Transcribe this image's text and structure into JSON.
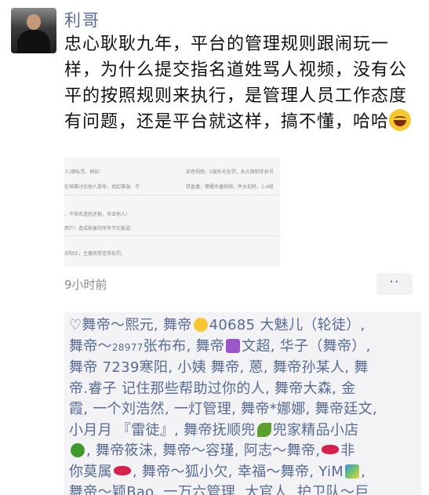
{
  "post": {
    "author": "利哥",
    "text": "忠心耿耿九年，平台的管理规则跟闹玩一样，为什么提交指名道姓骂人视频，没有公平的按照规则来执行，是管理人员工作态度有问题，还是平台就这样，搞不懂，哈哈",
    "emoji": "grinning-face-icon",
    "time": "9小时前",
    "more_label": "··"
  },
  "comment_lines": [
    {
      "a": "♡舞帝～熙元, 舞帝",
      "emoji": "kiss",
      "b": "40685 大魅儿（轮徒）,"
    },
    {
      "a": "舞帝～",
      "small": "28977",
      "b": "张布布, 舞帝",
      "emoji": "note",
      "c": "文超, 华子（舞帝）,"
    },
    {
      "a": "舞帝 7239寒阳, 小姨 舞帝, 蒽, 舞帝孙某人, 舞"
    },
    {
      "a": "帝.睿子  记住那些帮助过你的人, 舞帝大森, 金"
    },
    {
      "a": "霞, 一个刘浩然, 一灯管理, 舞帝*娜娜, 舞帝廷文,"
    },
    {
      "a": "小月月 『雷徒』, 舞帝抚顺兜",
      "emoji": "leaf",
      "b": "兜家精品小店"
    },
    {
      "a": "",
      "emoji": "clover",
      "b": ", 舞帝筱沫, 舞帝～容瑾, 阿志～舞帝,",
      "emoji2": "lips",
      "c": "非"
    },
    {
      "a": "你莫属",
      "emoji": "lips",
      "b": ", 舞帝～狐小欠, 幸福～舞帝, YiM",
      "emoji2": "rainbow",
      "c": ","
    },
    {
      "a": "舞帝～颖Bao, 一万六管理, 大官人, 护卫队～巨"
    }
  ]
}
